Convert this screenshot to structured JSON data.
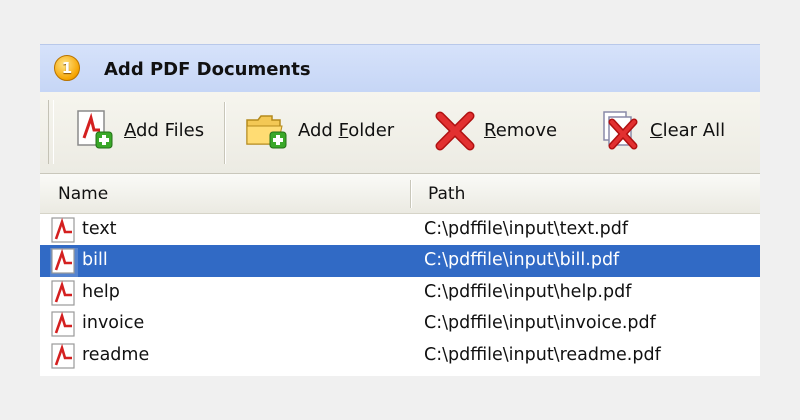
{
  "step": {
    "number": "1",
    "title": "Add PDF Documents"
  },
  "toolbar": {
    "add_files": {
      "pre": "",
      "key": "A",
      "post": "dd Files",
      "icon": "pdf-add-icon"
    },
    "add_folder": {
      "pre": "Add ",
      "key": "F",
      "post": "older",
      "icon": "folder-add-icon"
    },
    "remove": {
      "pre": "",
      "key": "R",
      "post": "emove",
      "icon": "red-x-icon"
    },
    "clear_all": {
      "pre": "",
      "key": "C",
      "post": "lear All",
      "icon": "clear-all-icon"
    }
  },
  "table": {
    "columns": {
      "name": "Name",
      "path": "Path"
    },
    "rows": [
      {
        "name": "text",
        "path": "C:\\pdffile\\input\\text.pdf",
        "selected": false
      },
      {
        "name": "bill",
        "path": "C:\\pdffile\\input\\bill.pdf",
        "selected": true
      },
      {
        "name": "help",
        "path": "C:\\pdffile\\input\\help.pdf",
        "selected": false
      },
      {
        "name": "invoice",
        "path": "C:\\pdffile\\input\\invoice.pdf",
        "selected": false
      },
      {
        "name": "readme",
        "path": "C:\\pdffile\\input\\readme.pdf",
        "selected": false
      }
    ]
  },
  "colors": {
    "header_bg": "#c6d6f6",
    "selection": "#316ac5",
    "badge": "#f6a400",
    "pdf_red": "#d42020",
    "add_green": "#3aa829"
  }
}
